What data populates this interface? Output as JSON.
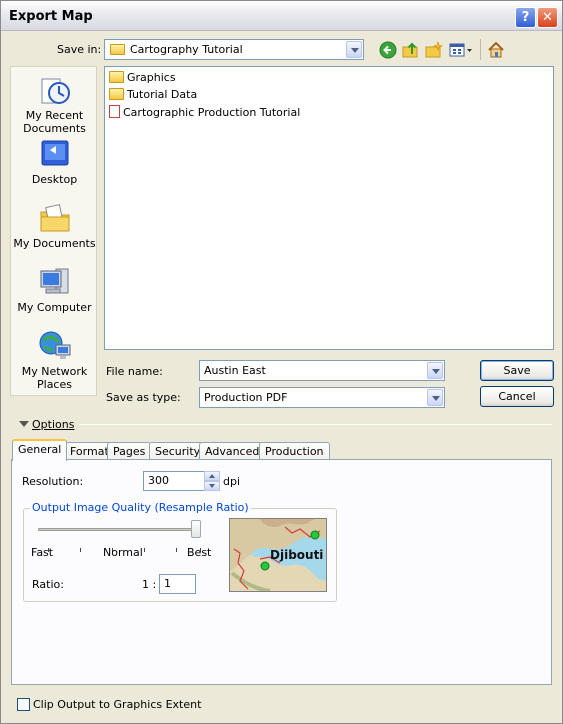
{
  "window": {
    "title": "Export Map"
  },
  "save_in": {
    "label": "Save in:",
    "value": "Cartography Tutorial"
  },
  "toolbar": {
    "icons": [
      "back-icon",
      "up-folder-icon",
      "new-folder-icon",
      "views-menu-icon",
      "home-icon"
    ]
  },
  "places": [
    {
      "label": "My Recent Documents",
      "icon": "recent-documents-icon"
    },
    {
      "label": "Desktop",
      "icon": "desktop-icon"
    },
    {
      "label": "My Documents",
      "icon": "my-documents-icon"
    },
    {
      "label": "My Computer",
      "icon": "my-computer-icon"
    },
    {
      "label": "My Network Places",
      "icon": "network-places-icon"
    }
  ],
  "files": [
    {
      "name": "Graphics",
      "type": "folder"
    },
    {
      "name": "Tutorial Data",
      "type": "folder"
    },
    {
      "name": "Cartographic Production Tutorial",
      "type": "pdf"
    }
  ],
  "file_name": {
    "label": "File name:",
    "value": "Austin East"
  },
  "save_as_type": {
    "label": "Save as type:",
    "value": "Production PDF"
  },
  "buttons": {
    "save": "Save",
    "cancel": "Cancel"
  },
  "options": {
    "label": "Options"
  },
  "tabs": [
    {
      "label": "General",
      "active": true
    },
    {
      "label": "Format",
      "active": false
    },
    {
      "label": "Pages",
      "active": false
    },
    {
      "label": "Security",
      "active": false
    },
    {
      "label": "Advanced",
      "active": false
    },
    {
      "label": "Production",
      "active": false
    }
  ],
  "general": {
    "resolution_label": "Resolution:",
    "resolution_value": "300",
    "resolution_unit": "dpi",
    "quality_group_title": "Output Image Quality (Resample Ratio)",
    "quality_level": 1.0,
    "slider_labels": {
      "fast": "Fast",
      "normal": "Normal",
      "best": "Best"
    },
    "ratio_label": "Ratio:",
    "ratio_prefix": "1 :",
    "ratio_value": "1",
    "preview_label": "Djibouti"
  },
  "clip_output": {
    "label": "Clip Output to Graphics Extent",
    "checked": false
  },
  "colors": {
    "accent": "#0046D5",
    "tab_highlight": "#F7C340",
    "face": "#ECE9D8"
  }
}
